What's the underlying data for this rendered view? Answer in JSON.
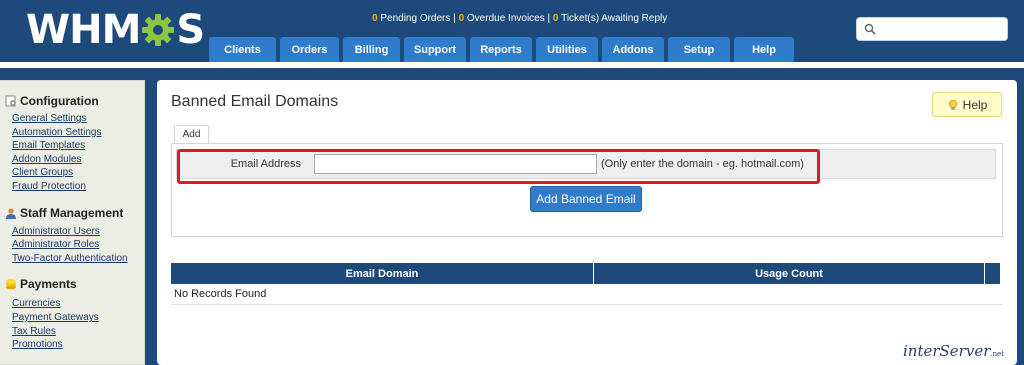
{
  "header": {
    "logo_left": "WHM",
    "logo_right": "S",
    "status": {
      "pending_orders_count": "0",
      "pending_orders_label": "Pending Orders",
      "overdue_invoices_count": "0",
      "overdue_invoices_label": "Overdue Invoices",
      "tickets_count": "0",
      "tickets_label": "Ticket(s) Awaiting Reply",
      "separator": "|"
    },
    "search": {
      "value": "",
      "placeholder": ""
    },
    "nav": [
      {
        "label": "Clients"
      },
      {
        "label": "Orders"
      },
      {
        "label": "Billing"
      },
      {
        "label": "Support"
      },
      {
        "label": "Reports"
      },
      {
        "label": "Utilities"
      },
      {
        "label": "Addons"
      },
      {
        "label": "Setup"
      },
      {
        "label": "Help"
      }
    ]
  },
  "sidebar": {
    "sections": [
      {
        "heading": "Configuration",
        "icon": "gear-doc-icon",
        "links": [
          "General Settings",
          "Automation Settings",
          "Email Templates",
          "Addon Modules",
          "Client Groups",
          "Fraud Protection"
        ]
      },
      {
        "heading": "Staff Management",
        "icon": "user-icon",
        "links": [
          "Administrator Users",
          "Administrator Roles",
          "Two-Factor Authentication"
        ]
      },
      {
        "heading": "Payments",
        "icon": "coins-icon",
        "links": [
          "Currencies",
          "Payment Gateways",
          "Tax Rules",
          "Promotions"
        ]
      }
    ]
  },
  "main": {
    "title": "Banned Email Domains",
    "help_label": "Help",
    "tab_label": "Add",
    "form": {
      "email_label": "Email Address",
      "email_value": "",
      "hint": "(Only enter the domain - eg. hotmail.com)",
      "submit_label": "Add Banned Email"
    },
    "table": {
      "columns": [
        "Email Domain",
        "Usage Count"
      ],
      "empty_text": "No Records Found"
    }
  },
  "watermark": {
    "text": "interServer",
    "suffix": ".net"
  },
  "colors": {
    "header_bg": "#1e4a7b",
    "nav_tab": "#2f7ccd",
    "highlight": "#d91c24",
    "status_number": "#f5b400",
    "help_bg": "#ffffcc"
  }
}
